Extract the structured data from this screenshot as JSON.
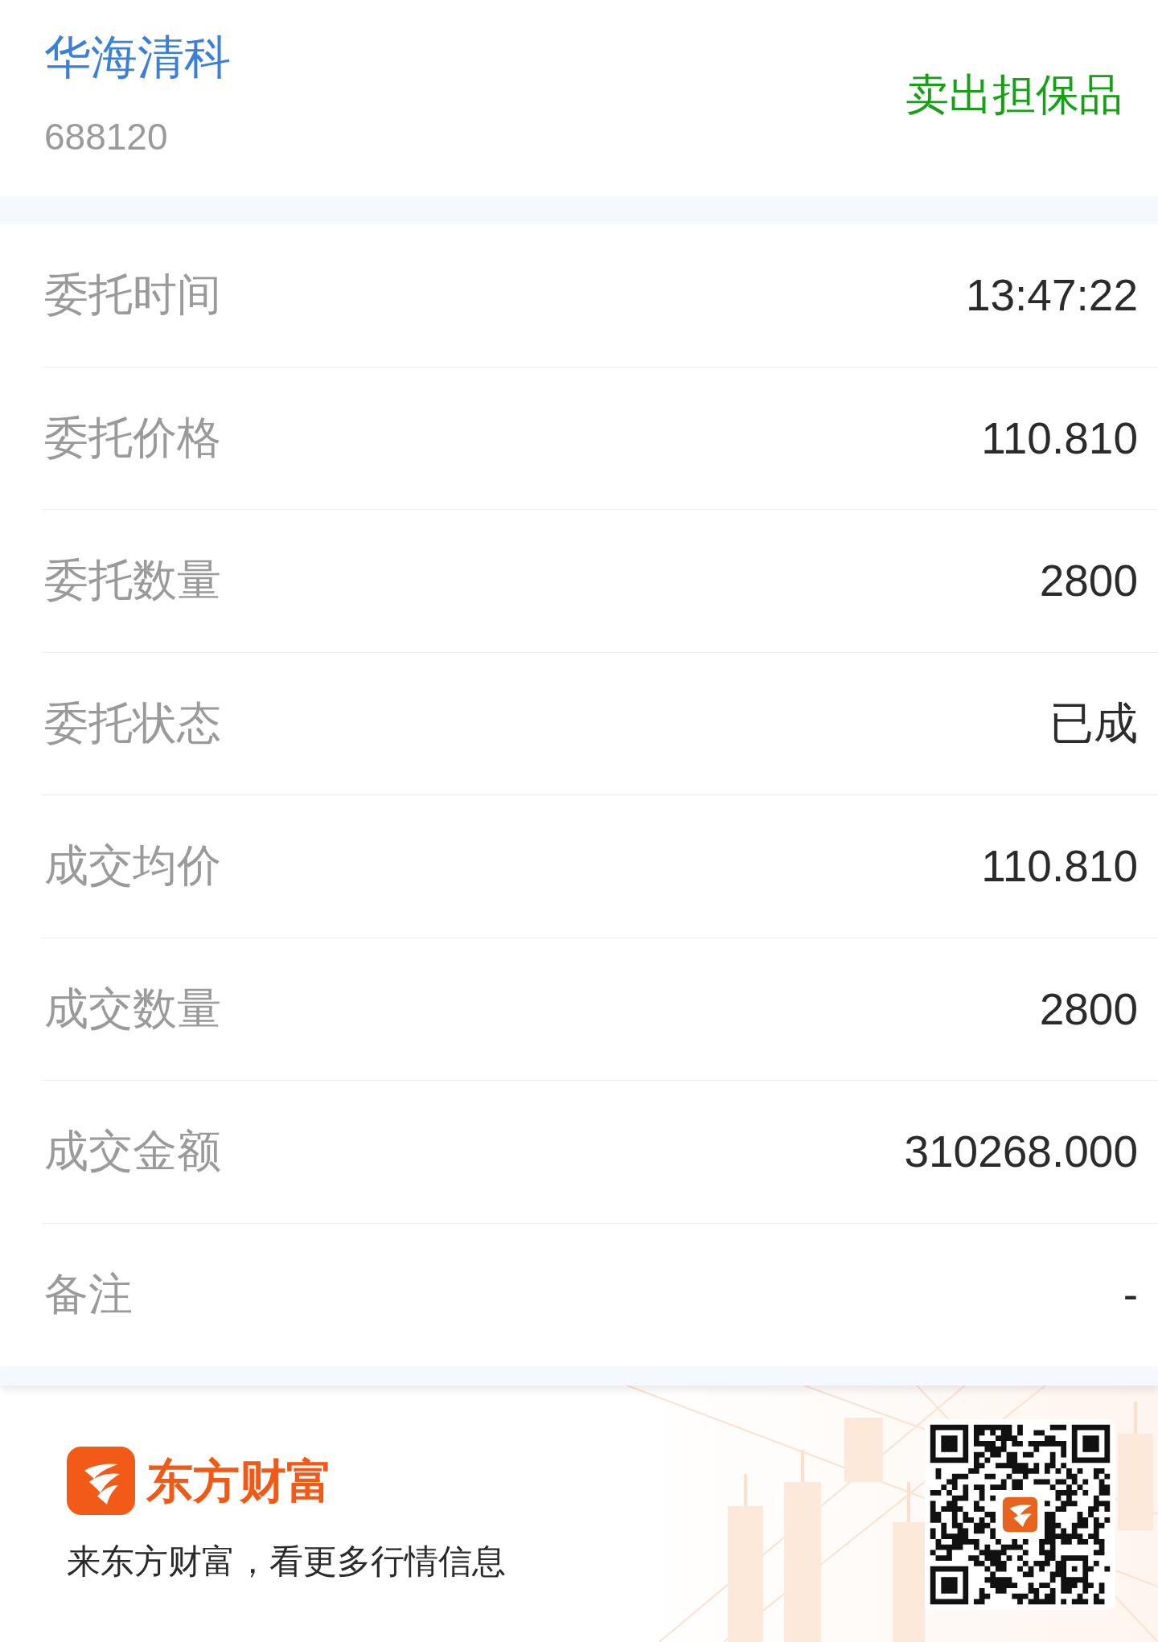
{
  "header": {
    "stock_name": "华海清科",
    "stock_code": "688120",
    "order_type": "卖出担保品"
  },
  "details": [
    {
      "label": "委托时间",
      "value": "13:47:22"
    },
    {
      "label": "委托价格",
      "value": "110.810"
    },
    {
      "label": "委托数量",
      "value": "2800"
    },
    {
      "label": "委托状态",
      "value": "已成"
    },
    {
      "label": "成交均价",
      "value": "110.810"
    },
    {
      "label": "成交数量",
      "value": "2800"
    },
    {
      "label": "成交金额",
      "value": "310268.000"
    },
    {
      "label": "备注",
      "value": "-"
    }
  ],
  "footer": {
    "brand_name": "东方财富",
    "tagline": "来东方财富，看更多行情信息"
  }
}
